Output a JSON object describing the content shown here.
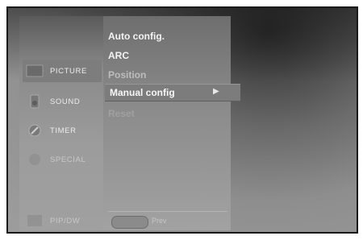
{
  "sidebar": {
    "items": [
      {
        "label": "PICTURE",
        "icon": "picture-icon"
      },
      {
        "label": "SOUND",
        "icon": "speaker-icon"
      },
      {
        "label": "TIMER",
        "icon": "clock-icon"
      },
      {
        "label": "SPECIAL",
        "icon": "special-icon"
      },
      {
        "label": "PIP/DW",
        "icon": "pip-icon"
      }
    ],
    "active_index": 0
  },
  "submenu": {
    "items": [
      {
        "label": "Auto config."
      },
      {
        "label": "ARC"
      },
      {
        "label": "Position"
      },
      {
        "label": "Manual config",
        "arrow": "▶"
      },
      {
        "label": "Reset"
      }
    ],
    "selected_index": 3
  },
  "footer": {
    "prev_label": "Prev"
  }
}
